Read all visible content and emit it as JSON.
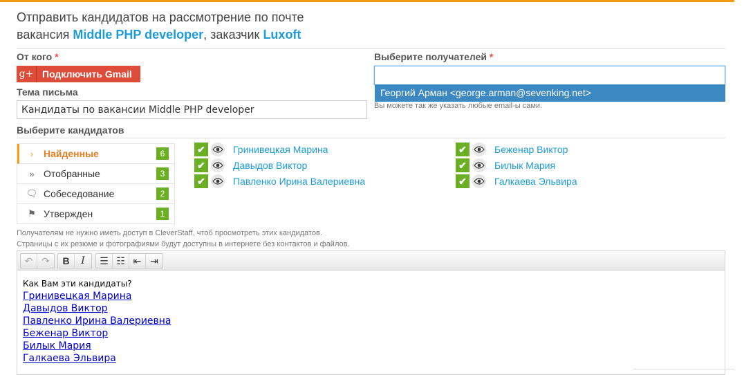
{
  "title": {
    "line1": "Отправить кандидатов на рассмотрение по почте",
    "prefix": "вакансия ",
    "vacancy": "Middle PHP developer",
    "middle": ", заказчик ",
    "client": "Luxoft"
  },
  "from": {
    "label": "От кого",
    "required": "*",
    "gmail_icon": "g+",
    "gmail_button": "Подключить Gmail"
  },
  "subject": {
    "label": "Тема письма",
    "value": "Кандидаты по вакансии Middle PHP developer"
  },
  "recipients": {
    "label": "Выберите получателей",
    "required": "*",
    "value": "",
    "suggestion": "Георгий Арман <george.arman@sevenking.net>",
    "hint": "Вы можете так же указать любые email-ы сами."
  },
  "candidates_section": {
    "label": "Выберите кандидатов"
  },
  "stages": [
    {
      "icon": "chevron-right-icon",
      "glyph": "›",
      "name": "Найденные",
      "count": "6",
      "active": true
    },
    {
      "icon": "double-chevron-icon",
      "glyph": "»",
      "name": "Отобранные",
      "count": "3",
      "active": false
    },
    {
      "icon": "chat-icon",
      "glyph": "🗨",
      "name": "Собеседование",
      "count": "2",
      "active": false
    },
    {
      "icon": "flag-icon",
      "glyph": "⚑",
      "name": "Утвержден",
      "count": "1",
      "active": false
    }
  ],
  "candidates_col1": [
    "Гринивецкая Марина",
    "Давыдов Виктор",
    "Павленко Ирина Валериевна"
  ],
  "candidates_col2": [
    "Беженар Виктор",
    "Билык Мария",
    "Галкаева Эльвира"
  ],
  "notice": {
    "line1": "Получателям не нужно иметь доступ в CleverStaff, чтоб просмотреть этих кандидатов.",
    "line2": "Страницы с их резюме и фотографиями будут доступны в интернете без контактов и файлов."
  },
  "editor": {
    "toolbar": {
      "undo": "↶",
      "redo": "↷",
      "bold": "B",
      "italic": "I",
      "bullets": "☰",
      "numbered": "☷",
      "outdent": "⇤",
      "indent": "⇥"
    },
    "question": "Как Вам эти кандидаты?",
    "links": [
      "Гринивецкая Марина",
      "Давыдов Виктор",
      "Павленко Ирина Валериевна",
      "Беженар Виктор",
      "Билык Мария",
      "Галкаева Эльвира"
    ]
  },
  "colors": {
    "accent": "#f39c12",
    "link": "#1e9bd7",
    "gmail": "#dd4b39",
    "count_badge": "#6bb024",
    "selected": "#3b88c3"
  }
}
